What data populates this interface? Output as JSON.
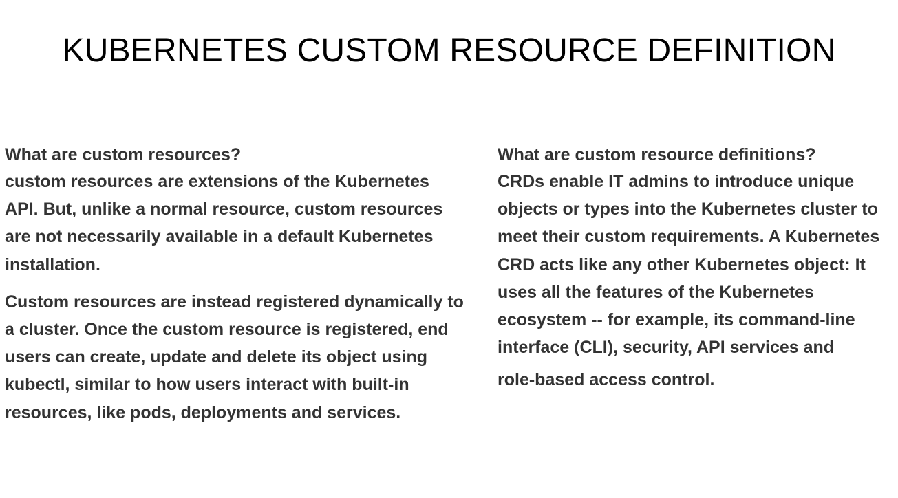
{
  "title": "KUBERNETES CUSTOM RESOURCE DEFINITION",
  "left": {
    "heading": "What are custom resources?",
    "paragraphs": [
      "custom resources are extensions of the Kubernetes API. But, unlike a normal resource, custom resources are not necessarily available in a default Kubernetes installation.",
      "Custom resources are instead registered dynamically to a cluster. Once the custom resource is registered, end users can create, update and delete its object using kubectl, similar to how users interact with built-in resources, like pods, deployments and services."
    ]
  },
  "right": {
    "heading": "What are custom resource definitions?",
    "paragraph": "CRDs enable IT admins to introduce unique objects or types into the Kubernetes cluster to meet their custom requirements. A Kubernetes CRD acts like any other Kubernetes object: It uses all the features of the Kubernetes ecosystem -- for example, its command-line interface (CLI), security, API services and",
    "trailing": "role-based access control."
  }
}
